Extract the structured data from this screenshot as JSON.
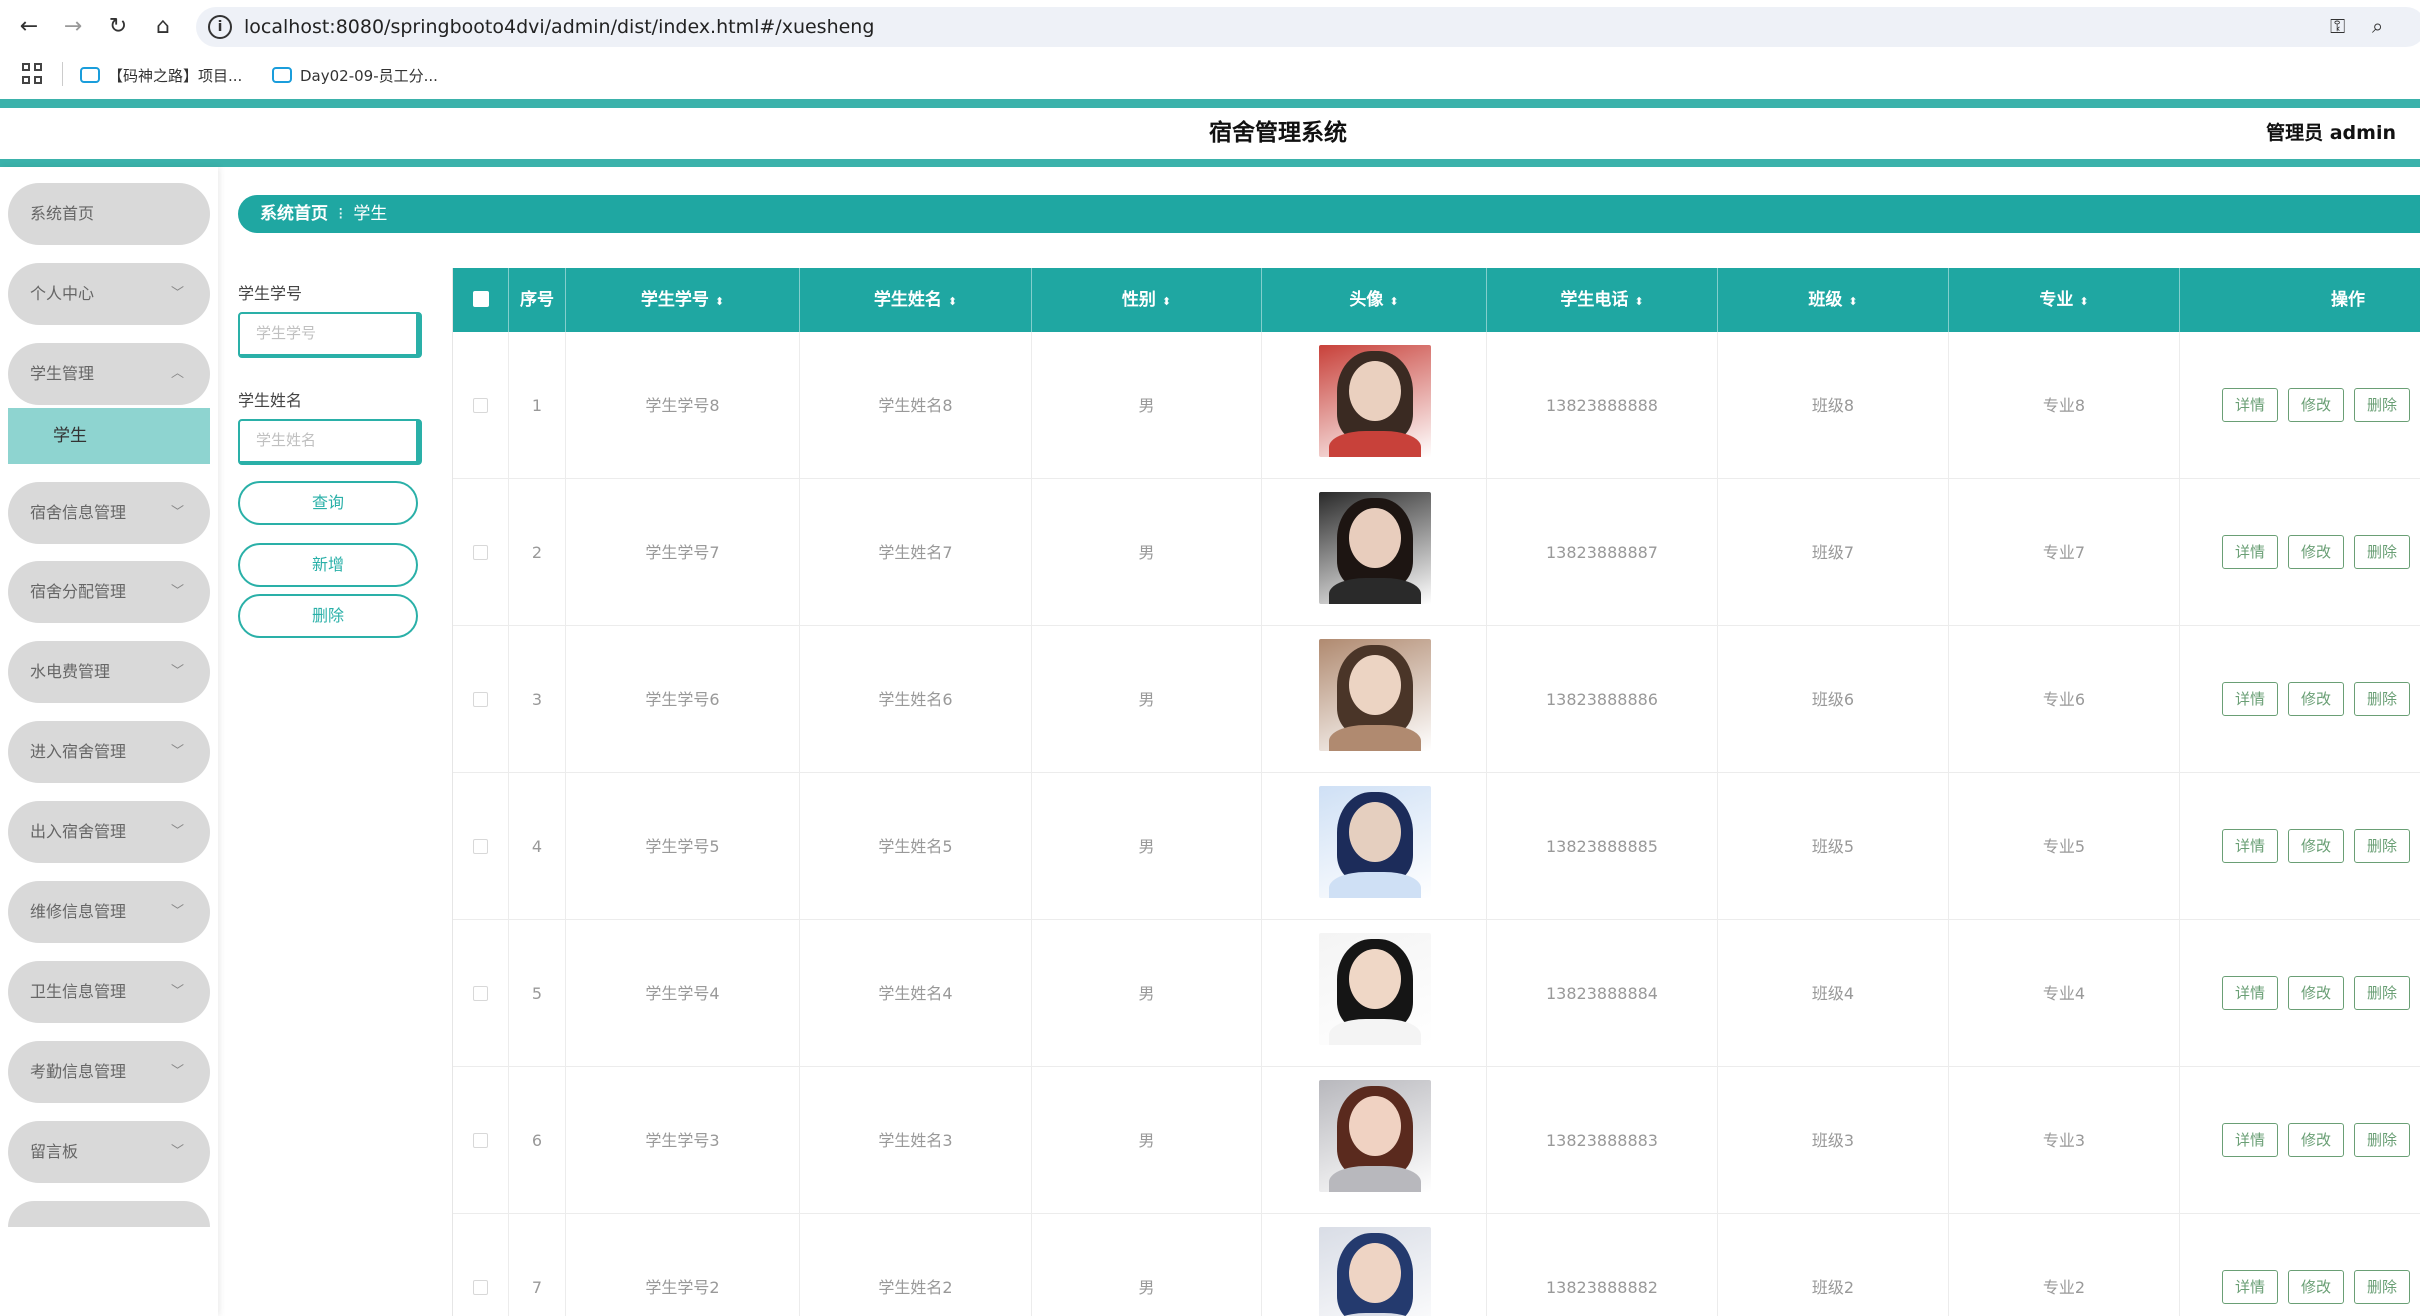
{
  "browser": {
    "url": "localhost:8080/springbooto4dvi/admin/dist/index.html#/xuesheng",
    "bookmarks": [
      "【码神之路】项目...",
      "Day02-09-员工分..."
    ]
  },
  "app": {
    "title": "宿舍管理系统",
    "admin_label": "管理员 admin"
  },
  "sidebar": {
    "items": [
      {
        "label": "系统首页"
      },
      {
        "label": "个人中心"
      },
      {
        "label": "学生管理"
      },
      {
        "label": "宿舍信息管理"
      },
      {
        "label": "宿舍分配管理"
      },
      {
        "label": "水电费管理"
      },
      {
        "label": "进入宿舍管理"
      },
      {
        "label": "出入宿舍管理"
      },
      {
        "label": "维修信息管理"
      },
      {
        "label": "卫生信息管理"
      },
      {
        "label": "考勤信息管理"
      },
      {
        "label": "留言板"
      }
    ],
    "submenu": {
      "label": "学生"
    }
  },
  "breadcrumb": {
    "home": "系统首页",
    "sep": "⁝",
    "current": "学生"
  },
  "filters": {
    "id_label": "学生学号",
    "id_placeholder": "学生学号",
    "name_label": "学生姓名",
    "name_placeholder": "学生姓名",
    "query_button": "查询",
    "add_button": "新增",
    "delete_button": "删除"
  },
  "table": {
    "headers": {
      "index": "序号",
      "id": "学生学号",
      "name": "学生姓名",
      "gender": "性别",
      "avatar": "头像",
      "phone": "学生电话",
      "class": "班级",
      "major": "专业",
      "actions": "操作"
    },
    "action_labels": {
      "detail": "详情",
      "edit": "修改",
      "delete": "删除"
    },
    "rows": [
      {
        "index": "1",
        "id": "学生学号8",
        "name": "学生姓名8",
        "gender": "男",
        "phone": "13823888888",
        "class": "班级8",
        "major": "专业8"
      },
      {
        "index": "2",
        "id": "学生学号7",
        "name": "学生姓名7",
        "gender": "男",
        "phone": "13823888887",
        "class": "班级7",
        "major": "专业7"
      },
      {
        "index": "3",
        "id": "学生学号6",
        "name": "学生姓名6",
        "gender": "男",
        "phone": "13823888886",
        "class": "班级6",
        "major": "专业6"
      },
      {
        "index": "4",
        "id": "学生学号5",
        "name": "学生姓名5",
        "gender": "男",
        "phone": "13823888885",
        "class": "班级5",
        "major": "专业5"
      },
      {
        "index": "5",
        "id": "学生学号4",
        "name": "学生姓名4",
        "gender": "男",
        "phone": "13823888884",
        "class": "班级4",
        "major": "专业4"
      },
      {
        "index": "6",
        "id": "学生学号3",
        "name": "学生姓名3",
        "gender": "男",
        "phone": "13823888883",
        "class": "班级3",
        "major": "专业3"
      },
      {
        "index": "7",
        "id": "学生学号2",
        "name": "学生姓名2",
        "gender": "男",
        "phone": "13823888882",
        "class": "班级2",
        "major": "专业2"
      }
    ]
  },
  "colors": {
    "accent": "#1fa7a2",
    "submenu_active": "#8ed4d0",
    "action_green": "#6a9f75"
  }
}
